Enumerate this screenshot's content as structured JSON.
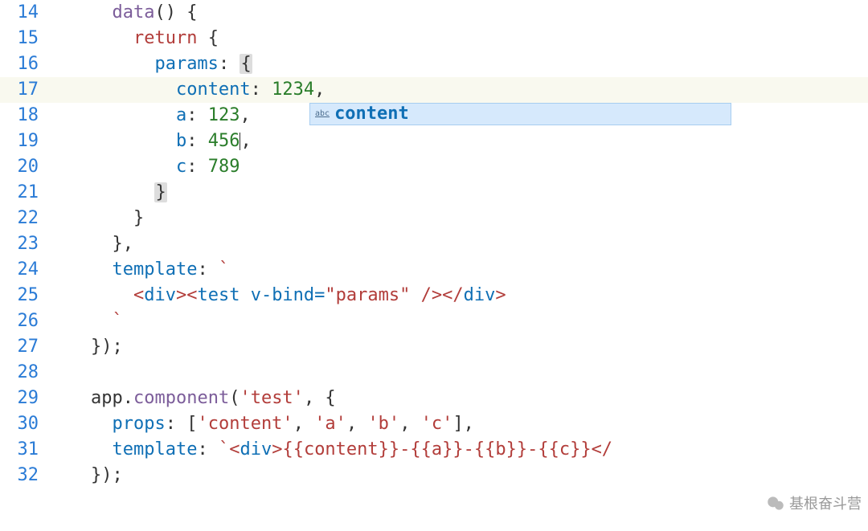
{
  "gutter": {
    "start": 14,
    "end": 32
  },
  "code": {
    "l14": {
      "indent": "      ",
      "fn": "data",
      "rest": "() {"
    },
    "l15": {
      "indent": "        ",
      "kw": "return",
      "rest": " {"
    },
    "l16": {
      "indent": "          ",
      "prop": "params",
      "colon": ": ",
      "brace": "{"
    },
    "l17": {
      "indent": "            ",
      "prop": "content",
      "colon": ": ",
      "num": "1234",
      "comma": ","
    },
    "l18": {
      "indent": "            ",
      "prop": "a",
      "colon": ": ",
      "num": "123",
      "comma": ","
    },
    "l19": {
      "indent": "            ",
      "prop": "b",
      "colon": ": ",
      "num": "456",
      "comma": ","
    },
    "l20": {
      "indent": "            ",
      "prop": "c",
      "colon": ": ",
      "num": "789"
    },
    "l21": {
      "indent": "          ",
      "brace": "}"
    },
    "l22": {
      "indent": "        ",
      "brace": "}"
    },
    "l23": {
      "indent": "      ",
      "brace": "},"
    },
    "l24": {
      "indent": "      ",
      "prop": "template",
      "colon": ": ",
      "tick": "`"
    },
    "l25": {
      "indent": "        ",
      "open1": "<",
      "tag1": "div",
      "close1": "><",
      "tag2": "test",
      "attr": " v-bind=",
      "val": "\"params\"",
      "selfclose": " />",
      "open2": "</",
      "tag3": "div",
      "close2": ">"
    },
    "l26": {
      "indent": "      ",
      "tick": "`"
    },
    "l27": {
      "indent": "    ",
      "brace": "});"
    },
    "l28": {
      "indent": ""
    },
    "l29": {
      "indent": "    ",
      "var": "app",
      "dot": ".",
      "method": "component",
      "paren": "(",
      "str": "'test'",
      "rest": ", {"
    },
    "l30": {
      "indent": "      ",
      "prop": "props",
      "colon": ": [",
      "s1": "'content'",
      "c1": ", ",
      "s2": "'a'",
      "c2": ", ",
      "s3": "'b'",
      "c3": ", ",
      "s4": "'c'",
      "end": "],"
    },
    "l31": {
      "indent": "      ",
      "prop": "template",
      "colon": ": ",
      "tick": "`",
      "open1": "<",
      "tag1": "div",
      "close1": ">",
      "expr": "{{content}}-{{a}}-{{b}}-{{c}}",
      "open2": "</"
    },
    "l32": {
      "indent": "    ",
      "brace": "});"
    }
  },
  "autocomplete": {
    "badge": "abc",
    "suggestion": "content"
  },
  "watermark": {
    "text": "基根奋斗营"
  }
}
